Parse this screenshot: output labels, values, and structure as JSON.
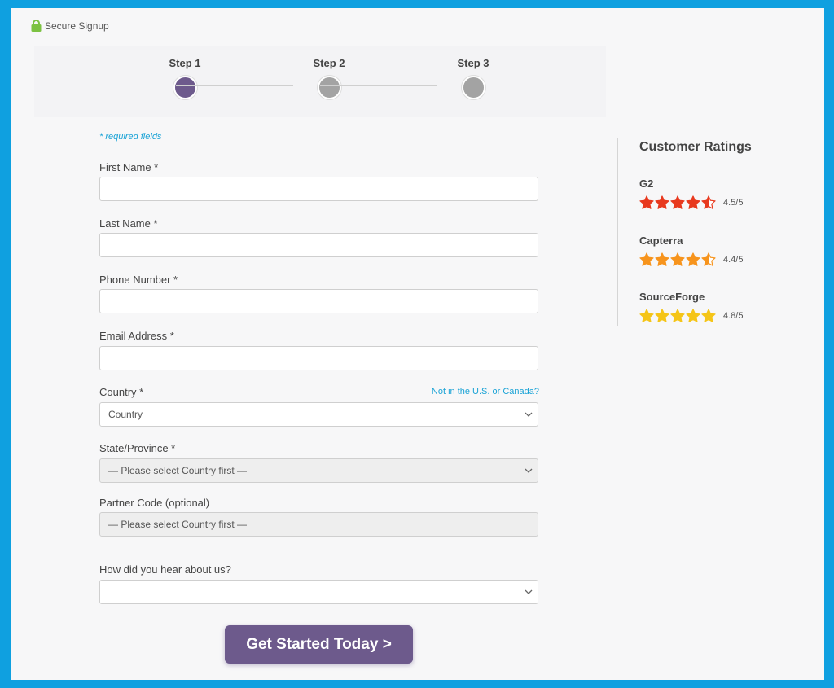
{
  "header": {
    "secure_label": "Secure Signup"
  },
  "steps": [
    {
      "label": "Step 1",
      "active": true
    },
    {
      "label": "Step 2",
      "active": false
    },
    {
      "label": "Step 3",
      "active": false
    }
  ],
  "form": {
    "required_note": "* required fields",
    "first_name": {
      "label": "First Name *",
      "value": ""
    },
    "last_name": {
      "label": "Last Name *",
      "value": ""
    },
    "phone": {
      "label": "Phone Number *",
      "value": ""
    },
    "email": {
      "label": "Email Address *",
      "value": ""
    },
    "country": {
      "label": "Country *",
      "selected": "Country",
      "link": "Not in the U.S. or Canada?"
    },
    "state": {
      "label": "State/Province *",
      "selected": "— Please select Country first —"
    },
    "partner": {
      "label": "Partner Code (optional)",
      "value": "— Please select Country first —"
    },
    "heard": {
      "label": "How did you hear about us?",
      "selected": ""
    },
    "submit_label": "Get Started Today >"
  },
  "ratings": {
    "title": "Customer Ratings",
    "items": [
      {
        "name": "G2",
        "score": "4.5/5",
        "value": 4.5,
        "color": "#e8391e"
      },
      {
        "name": "Capterra",
        "score": "4.4/5",
        "value": 4.4,
        "color": "#f7941d"
      },
      {
        "name": "SourceForge",
        "score": "4.8/5",
        "value": 4.8,
        "color": "#f5c518"
      }
    ]
  },
  "colors": {
    "accent": "#6d5a8c",
    "link": "#1aa3d6",
    "background": "#0fa0e0"
  }
}
